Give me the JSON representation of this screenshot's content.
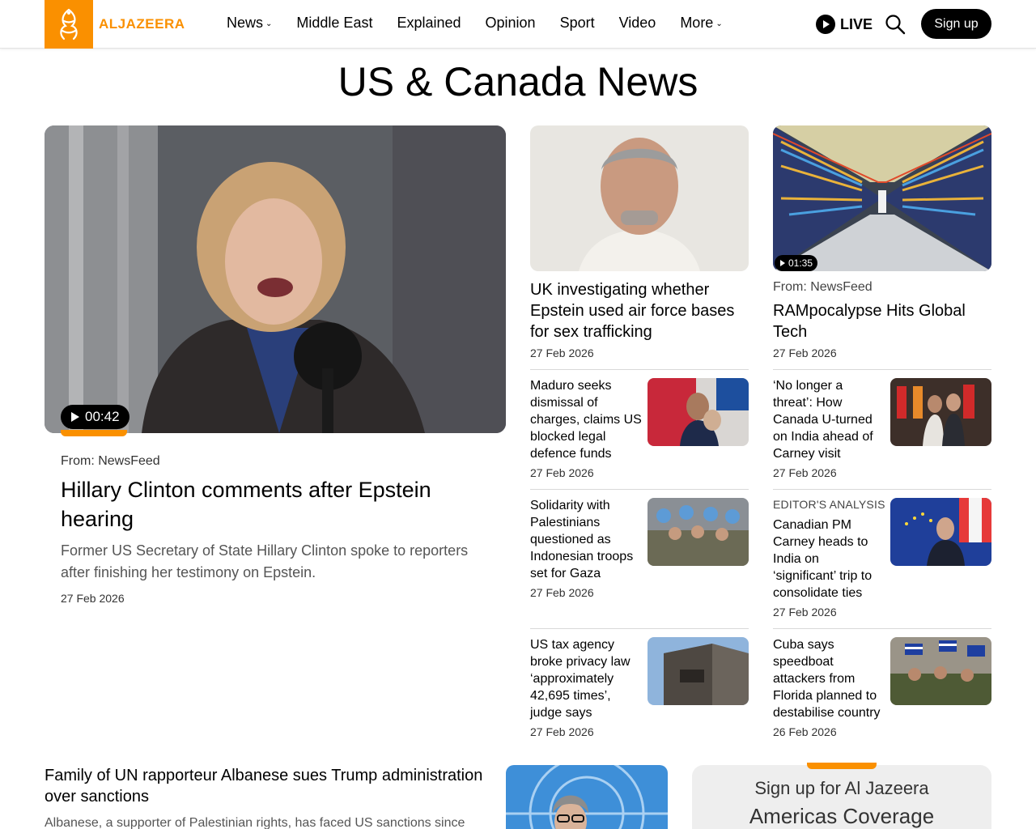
{
  "header": {
    "logo_text": "ALJAZEERA",
    "nav": [
      {
        "label": "News",
        "dropdown": true
      },
      {
        "label": "Middle East",
        "dropdown": false
      },
      {
        "label": "Explained",
        "dropdown": false
      },
      {
        "label": "Opinion",
        "dropdown": false
      },
      {
        "label": "Sport",
        "dropdown": false
      },
      {
        "label": "Video",
        "dropdown": false
      },
      {
        "label": "More",
        "dropdown": true
      }
    ],
    "live_label": "LIVE",
    "signup_label": "Sign up"
  },
  "page_title": "US & Canada News",
  "hero": {
    "duration": "00:42",
    "from": "From: NewsFeed",
    "title": "Hillary Clinton comments after Epstein hearing",
    "description": "Former US Secretary of State Hillary Clinton spoke to reporters after finishing her testimony on Epstein.",
    "date": "27 Feb 2026"
  },
  "col2": {
    "title": "UK investigating whether Epstein used air force bases for sex trafficking",
    "date": "27 Feb 2026",
    "items": [
      {
        "title": "Maduro seeks dismissal of charges, claims US blocked legal defence funds",
        "date": "27 Feb 2026"
      },
      {
        "title": "Solidarity with Palestinians questioned as Indonesian troops set for Gaza",
        "date": "27 Feb 2026"
      },
      {
        "title": "US tax agency broke privacy law ‘approximately 42,695 times’, judge says",
        "date": "27 Feb 2026"
      }
    ]
  },
  "col3": {
    "duration": "01:35",
    "from": "From: NewsFeed",
    "title": "RAMpocalypse Hits Global Tech",
    "date": "27 Feb 2026",
    "items": [
      {
        "kicker": "",
        "title": "‘No longer a threat’: How Canada U-turned on India ahead of Carney visit",
        "date": "27 Feb 2026"
      },
      {
        "kicker": "EDITOR'S ANALYSIS",
        "title": "Canadian PM Carney heads to India on ‘significant’ trip to consolidate ties",
        "date": "27 Feb 2026"
      },
      {
        "kicker": "",
        "title": "Cuba says speedboat attackers from Florida planned to destabilise country",
        "date": "26 Feb 2026"
      }
    ]
  },
  "bottom": {
    "title": "Family of UN rapporteur Albanese sues Trump administration over sanctions",
    "description": "Albanese, a supporter of Palestinian rights, has faced US sanctions since July"
  },
  "newsletter": {
    "line1": "Sign up for Al Jazeera",
    "line2": "Americas Coverage"
  },
  "colors": {
    "accent": "#fa9000",
    "text": "#000000"
  }
}
